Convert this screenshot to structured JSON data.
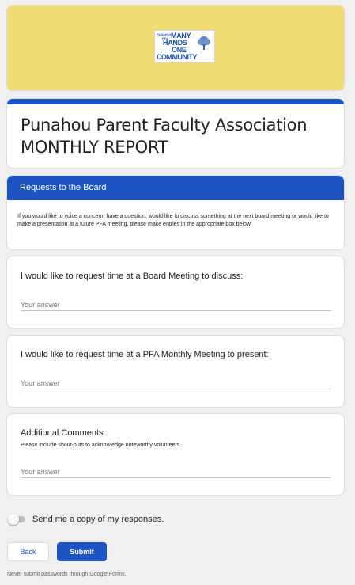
{
  "banner": {
    "logo": {
      "small_text": "PUNAHOU",
      "pfa_text": "PFA",
      "line1": "MANY",
      "line2": "HANDS",
      "line3": "ONE",
      "line4": "COMMUNITY",
      "color": "#1f4fa8"
    },
    "background_color": "#f1dc73"
  },
  "form": {
    "title": "Punahou Parent Faculty Association MONTHLY REPORT",
    "accent_color": "#1e53c3"
  },
  "section": {
    "title": "Requests to the Board",
    "description": "If you would like to voice a concern, have a question, would like to discuss something at the next board meeting or would like to make a presentation at a future PFA meeting, please make entries in the appropriate box below."
  },
  "questions": [
    {
      "title": "I would like to request time at a Board Meeting to discuss:",
      "help": "",
      "value": "",
      "placeholder": "Your answer"
    },
    {
      "title": "I would like to request time at a PFA Monthly Meeting to present:",
      "help": "",
      "value": "",
      "placeholder": "Your answer"
    },
    {
      "title": "Additional Comments",
      "help": "Please include shout-outs to acknowledge noteworthy volunteers.",
      "value": "",
      "placeholder": "Your answer"
    }
  ],
  "send_copy": {
    "label": "Send me a copy of my responses.",
    "checked": false
  },
  "buttons": {
    "back_label": "Back",
    "submit_label": "Submit"
  },
  "footer": {
    "note": "Never submit passwords through Google Forms."
  }
}
